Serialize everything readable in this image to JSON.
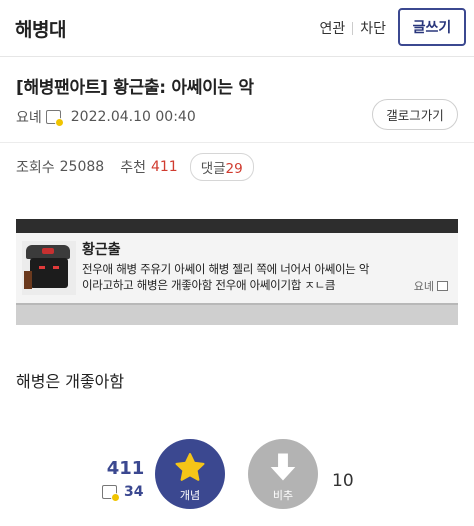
{
  "header": {
    "gallery_name": "해병대",
    "links": [
      "연관",
      "차단"
    ],
    "write_label": "글쓰기"
  },
  "post": {
    "title": "[해병팬아트] 황근출: 아쎄이는 악",
    "author": "요녜",
    "date": "2022.04.10 00:40",
    "gallery_button": "갤로그가기",
    "views_label": "조회수",
    "views": "25088",
    "recommend_label": "추천",
    "recommend": "411",
    "comments_label": "댓글",
    "comments": "29",
    "body": "해병은 개좋아함"
  },
  "embed": {
    "nickname": "황근출",
    "line1": "전우애 해병 주유기 아쎄이 해병 젤리 쪽에 너어서 아쎄이는 악",
    "line2": "이라고하고 해병은 개좋아함 전우애 아쎄이기합 ㅈㄴ큼",
    "user_tag": "요녜"
  },
  "vote": {
    "up_count": "411",
    "fix_count": "34",
    "up_label": "개념",
    "down_label": "비추",
    "down_count": "10"
  },
  "colors": {
    "accent": "#3b4890",
    "red": "#d03b2f",
    "down_gray": "#b3b3b3",
    "star": "#f5c518"
  }
}
